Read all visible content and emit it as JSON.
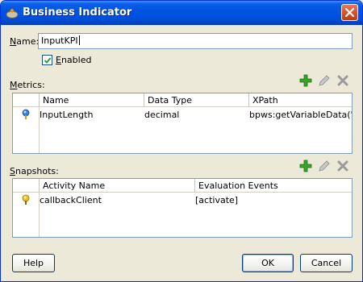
{
  "window": {
    "title": "Business Indicator",
    "icons": {
      "app": "bpel-process-icon",
      "close": "close-icon"
    }
  },
  "form": {
    "name_label_u": "N",
    "name_label_rest": "ame:",
    "name_value": "InputKPI",
    "enabled_label_u": "E",
    "enabled_label_rest": "nabled",
    "enabled_checked": true
  },
  "metrics": {
    "label_u": "M",
    "label_rest": "etrics:",
    "columns": [
      "Name",
      "Data Type",
      "XPath"
    ],
    "rows": [
      {
        "name": "InputLength",
        "data_type": "decimal",
        "xpath": "bpws:getVariableData('i...",
        "icon": "metric-icon"
      }
    ]
  },
  "snapshots": {
    "label_u": "S",
    "label_rest": "napshots:",
    "columns": [
      "Activity Name",
      "Evaluation Events"
    ],
    "rows": [
      {
        "activity": "callbackClient",
        "events": "[activate]",
        "icon": "snapshot-icon"
      }
    ]
  },
  "toolbar_icons": [
    "add-icon",
    "edit-icon",
    "delete-icon"
  ],
  "buttons": {
    "help": "Help",
    "ok": "OK",
    "cancel": "Cancel"
  },
  "colors": {
    "titlebar": "#0054e3",
    "add": "#3aa42a",
    "dialog_bg": "#ece9d8"
  }
}
